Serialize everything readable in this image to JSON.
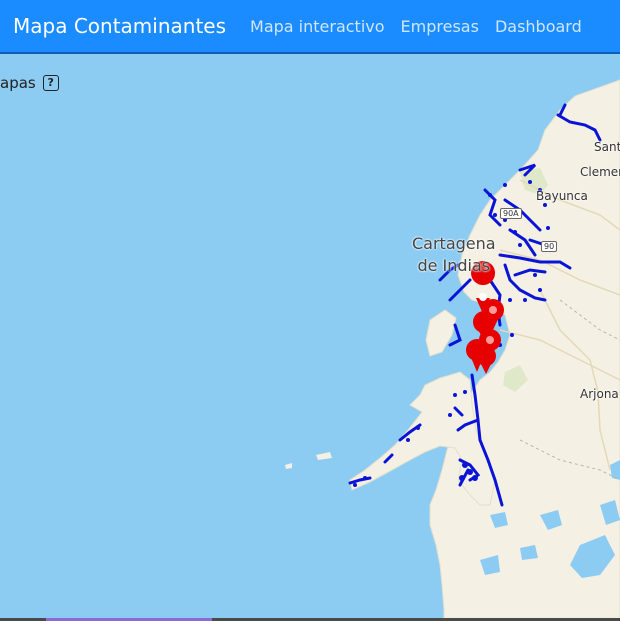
{
  "nav": {
    "brand": "Mapa Contaminantes",
    "links": [
      "Mapa interactivo",
      "Empresas",
      "Dashboard"
    ]
  },
  "layers_control": {
    "label": "apas",
    "help": "?"
  },
  "map": {
    "labels": {
      "cartagena": "Cartagena\nde Indias",
      "bayunca": "Bayunca",
      "clemencia": "Clemen",
      "santa": "Sant",
      "arjona": "Arjona"
    },
    "road_shields": [
      "90A",
      "90"
    ],
    "colors": {
      "water": "#8ccbf2",
      "land": "#f4f1e4",
      "pipes": "#0a14d6",
      "markers": "#e60000"
    }
  }
}
